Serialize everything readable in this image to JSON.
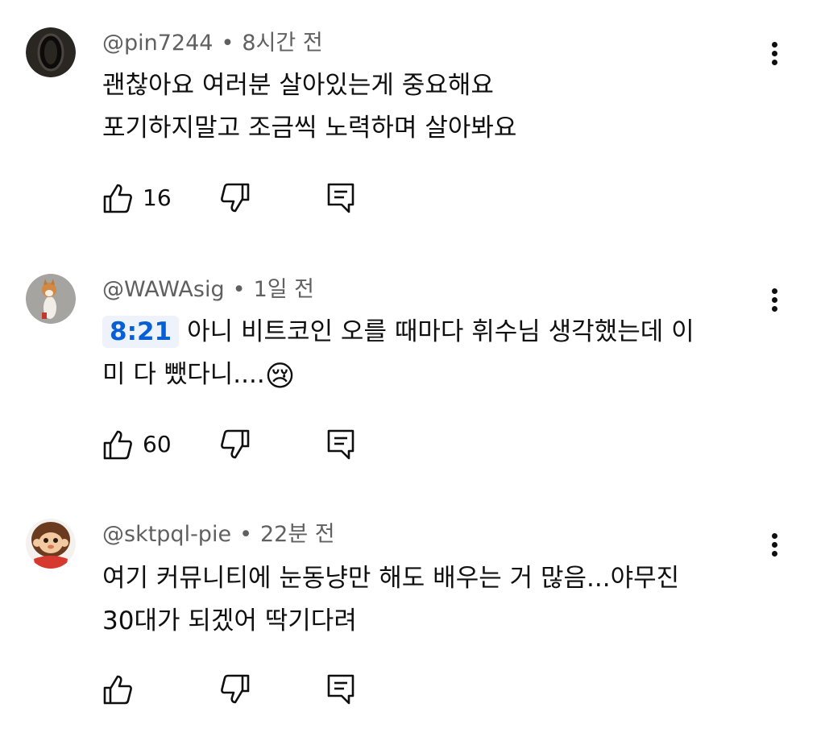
{
  "comments": [
    {
      "handle": "@pin7244",
      "separator": "•",
      "time": "8시간 전",
      "lines": [
        "괜찮아요 여러분 살아있는게 중요해요",
        "포기하지말고 조금씩 노력하며 살아봐요"
      ],
      "likes": "16",
      "avatar_icon": "ring-avatar-icon"
    },
    {
      "handle": "@WAWAsig",
      "separator": "•",
      "time": "1일 전",
      "timestamp_link": "8:21",
      "line1": "아니 비트코인 오를 때마다 휘수님 생각했는데 이",
      "line2": "미 다 뺐다니....",
      "emoji": "😢",
      "likes": "60",
      "avatar_icon": "shiba-dog-avatar-icon"
    },
    {
      "handle": "@sktpql-pie",
      "separator": "•",
      "time": "22분 전",
      "lines": [
        "여기 커뮤니티에 눈동냥만 해도 배우는 거 많음...야무진",
        "30대가 되겠어 딱기다려"
      ],
      "likes": "",
      "avatar_icon": "monchhichi-avatar-icon"
    }
  ],
  "colors": {
    "text": "#0f0f0f",
    "meta": "#606060",
    "link": "#065fd4",
    "link_bg": "#eef3fb"
  }
}
